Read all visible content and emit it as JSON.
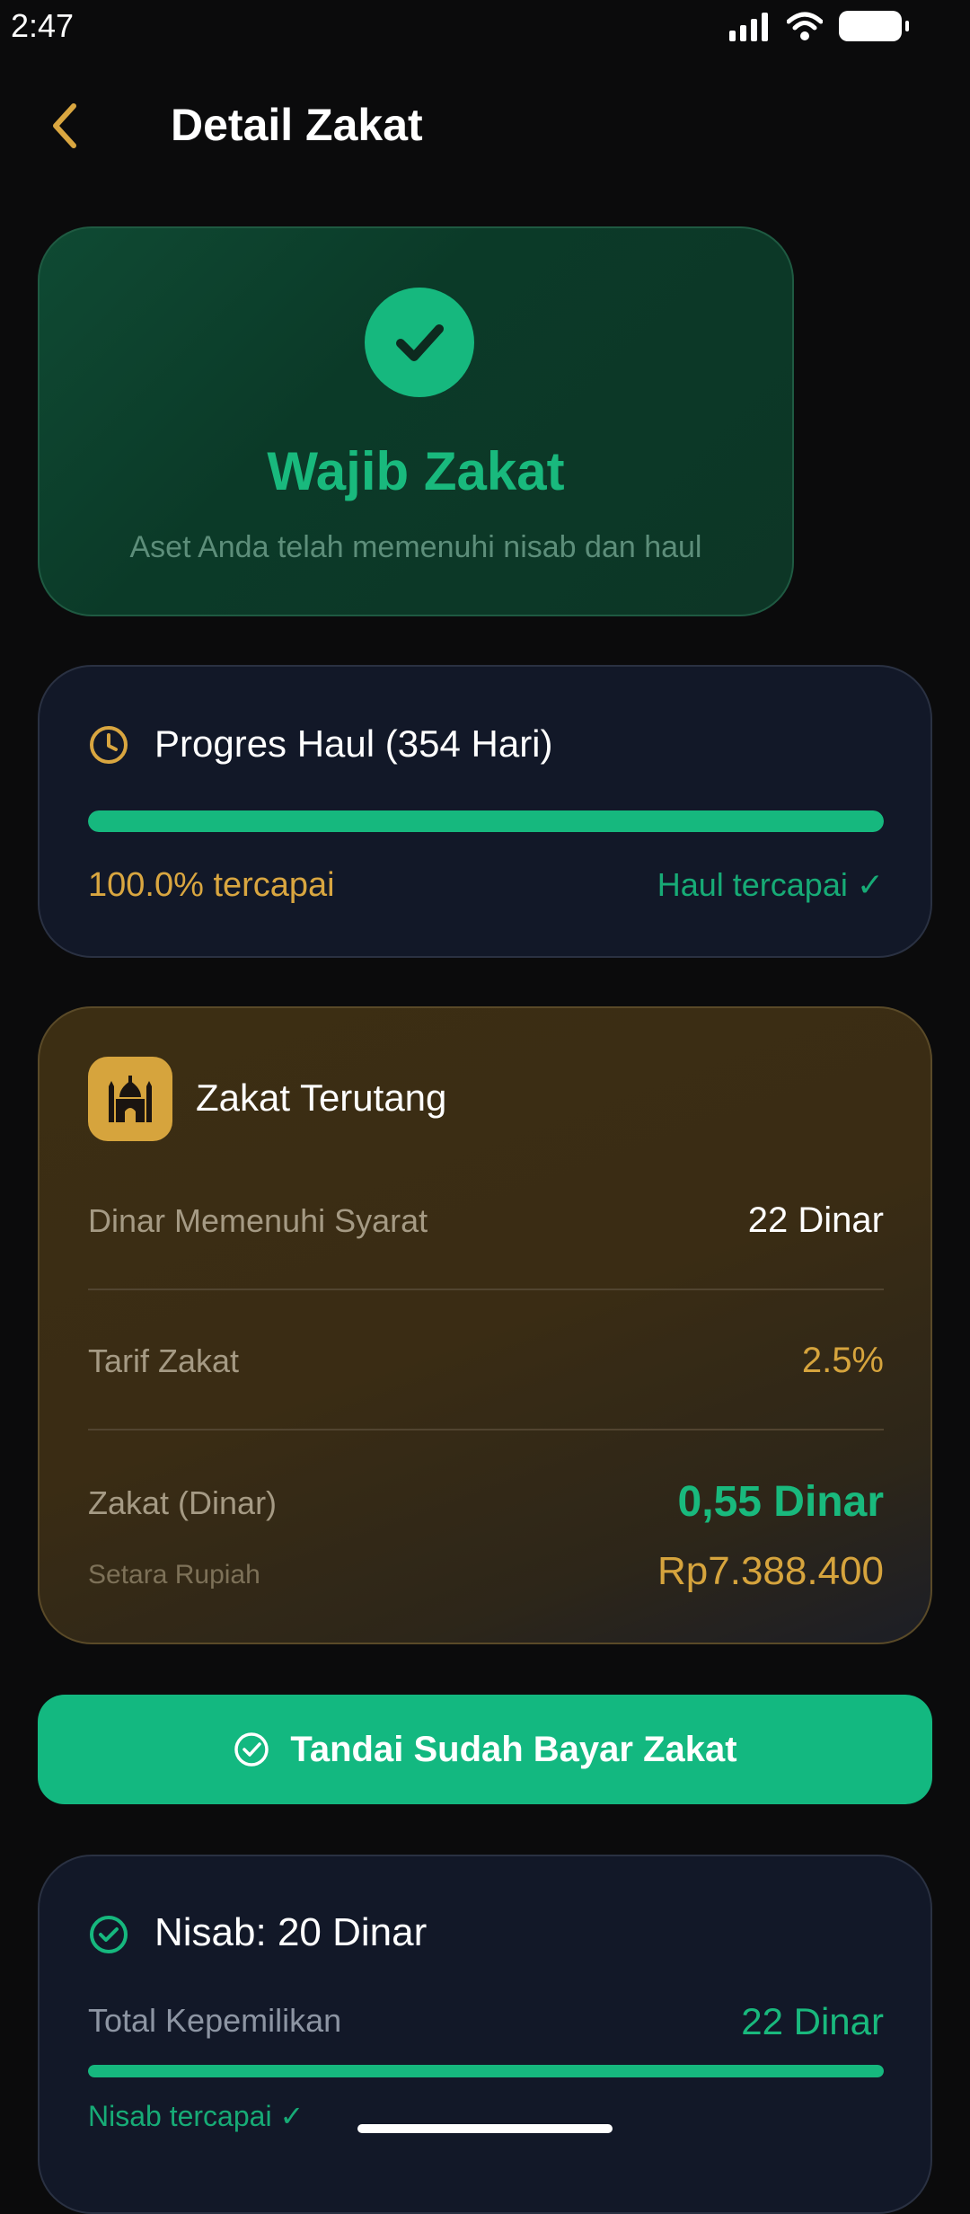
{
  "status_bar": {
    "time": "2:47"
  },
  "header": {
    "title": "Detail Zakat"
  },
  "status_card": {
    "title": "Wajib Zakat",
    "subtitle": "Aset Anda telah memenuhi nisab dan haul"
  },
  "haul": {
    "title": "Progres Haul (354 Hari)",
    "progress_percent": 100,
    "progress_text": "100.0% tercapai",
    "status": "Haul tercapai ✓"
  },
  "zakat": {
    "title": "Zakat Terutang",
    "rows": [
      {
        "label": "Dinar Memenuhi Syarat",
        "value": "22 Dinar"
      },
      {
        "label": "Tarif Zakat",
        "value": "2.5%"
      },
      {
        "label": "Zakat (Dinar)",
        "value": "0,55 Dinar"
      }
    ],
    "rupiah_label": "Setara Rupiah",
    "rupiah_value": "Rp7.388.400"
  },
  "actions": {
    "mark_paid_label": "Tandai Sudah Bayar Zakat"
  },
  "nisab": {
    "title": "Nisab: 20 Dinar",
    "owned_label": "Total Kepemilikan",
    "owned_value": "22 Dinar",
    "progress_percent": 100,
    "status": "Nisab tercapai ✓"
  },
  "colors": {
    "accent_green": "#16b87e",
    "accent_gold": "#d6a43d",
    "background": "#0b0b0c"
  },
  "icons": {
    "back": "chevron-left-icon",
    "check": "check-icon",
    "clock": "clock-icon",
    "mosque": "mosque-icon",
    "check_circle": "check-circle-icon"
  }
}
